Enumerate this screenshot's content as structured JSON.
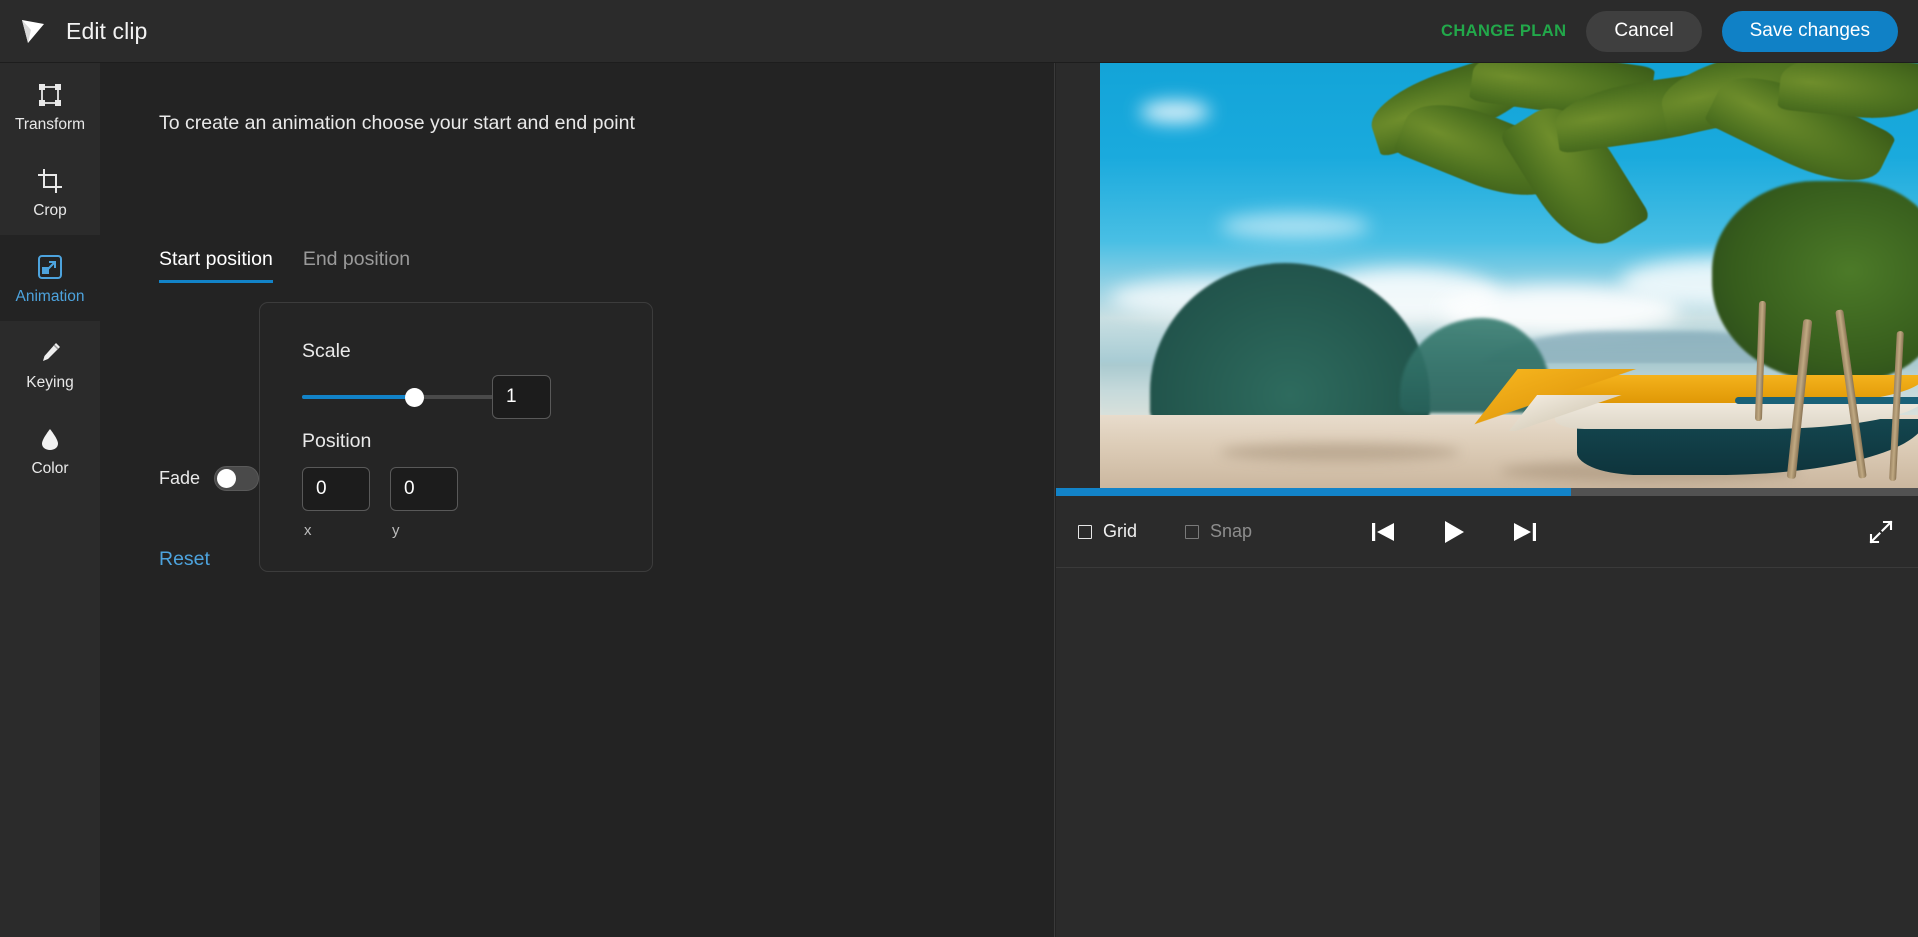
{
  "header": {
    "logo_icon": "paper-plane-logo",
    "title": "Edit clip",
    "change_plan_label": "CHANGE PLAN",
    "cancel_label": "Cancel",
    "save_label": "Save changes",
    "accent_blue": "#1081c6",
    "accent_green": "#22a84a"
  },
  "sidebar": {
    "items": [
      {
        "label": "Transform",
        "icon": "transform-icon",
        "active": false
      },
      {
        "label": "Crop",
        "icon": "crop-icon",
        "active": false
      },
      {
        "label": "Animation",
        "icon": "animation-icon",
        "active": true
      },
      {
        "label": "Keying",
        "icon": "eyedropper-icon",
        "active": false
      },
      {
        "label": "Color",
        "icon": "droplet-icon",
        "active": false
      }
    ],
    "active_color": "#4da3dd"
  },
  "panel": {
    "hint": "To create an animation choose your start and end point",
    "tabs": [
      {
        "label": "Start position",
        "active": true
      },
      {
        "label": "End position",
        "active": false
      }
    ],
    "scale": {
      "label": "Scale",
      "value": "1",
      "slider_percent": 51
    },
    "position": {
      "label": "Position",
      "x_value": "0",
      "y_value": "0",
      "x_caption": "x",
      "y_caption": "y"
    },
    "fade": {
      "label": "Fade",
      "enabled": false
    },
    "reset_label": "Reset"
  },
  "preview": {
    "scene_description": "Tropical beach with palm trees, limestone island and a traditional outrigger boat",
    "progress_percent": 59.7,
    "controls": {
      "grid_label": "Grid",
      "grid_checked": false,
      "grid_enabled": true,
      "snap_label": "Snap",
      "snap_checked": false,
      "snap_enabled": false,
      "skip_back_icon": "skip-to-start-icon",
      "play_icon": "play-icon",
      "skip_forward_icon": "skip-to-end-icon",
      "fullscreen_icon": "expand-icon"
    }
  }
}
